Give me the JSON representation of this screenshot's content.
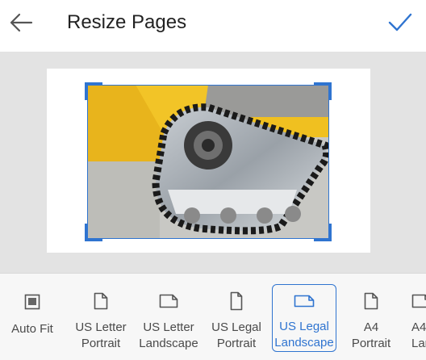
{
  "header": {
    "title": "Resize Pages",
    "back_icon": "arrow-left-icon",
    "confirm_icon": "checkmark-icon"
  },
  "colors": {
    "accent": "#2f74d0",
    "canvas_bg": "#e3e3e3",
    "toolbar_bg": "#f7f7f7"
  },
  "options": [
    {
      "line1": "Auto Fit",
      "line2": "",
      "icon": "image-icon",
      "selected": false
    },
    {
      "line1": "US Letter",
      "line2": "Portrait",
      "icon": "page-portrait-icon",
      "selected": false
    },
    {
      "line1": "US Letter",
      "line2": "Landscape",
      "icon": "page-landscape-icon",
      "selected": false
    },
    {
      "line1": "US Legal",
      "line2": "Portrait",
      "icon": "page-portrait-icon",
      "selected": false
    },
    {
      "line1": "US Legal",
      "line2": "Landscape",
      "icon": "page-landscape-icon",
      "selected": true
    },
    {
      "line1": "A4",
      "line2": "Portrait",
      "icon": "page-portrait-icon",
      "selected": false
    },
    {
      "line1": "A4",
      "line2": "Lan",
      "icon": "page-landscape-icon",
      "selected": false
    }
  ]
}
